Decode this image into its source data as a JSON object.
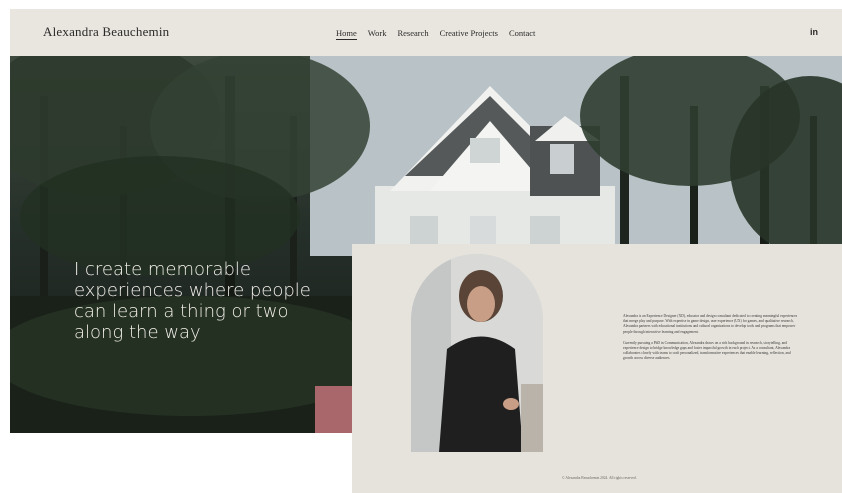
{
  "header": {
    "brand": "Alexandra Beauchemin",
    "nav": [
      {
        "label": "Home",
        "active": true
      },
      {
        "label": "Work",
        "active": false
      },
      {
        "label": "Research",
        "active": false
      },
      {
        "label": "Creative Projects",
        "active": false
      },
      {
        "label": "Contact",
        "active": false
      }
    ],
    "social_label": "in",
    "social_icon": "linkedin-icon"
  },
  "hero": {
    "headline": "I create memorable experiences where people can learn a thing or two along the way"
  },
  "about": {
    "bio_1": "Alexandra is an Experience Designer (XD), educator and design consultant dedicated to creating meaningful experiences that merge play and purpose. With expertise in game design, user experience (UX) for games, and qualitative research, Alexandra partners with educational institutions and cultural organizations to develop tools and programs that empower people through interactive learning and engagement.",
    "bio_2": "Currently pursuing a PhD in Communication, Alexandra draws on a rich background in research, storytelling, and experience design to bridge knowledge gaps and foster impactful growth in each project. As a consultant, Alexandra collaborates closely with teams to craft personalized, transformative experiences that enable learning, reflection, and growth across diverse audiences.",
    "copyright": "© Alexandra Beauchemin 2024. All rights reserved."
  },
  "colors": {
    "header_bg": "#e9e6e0",
    "panel_bg": "#e6e3dd",
    "text": "#2b2a28"
  }
}
